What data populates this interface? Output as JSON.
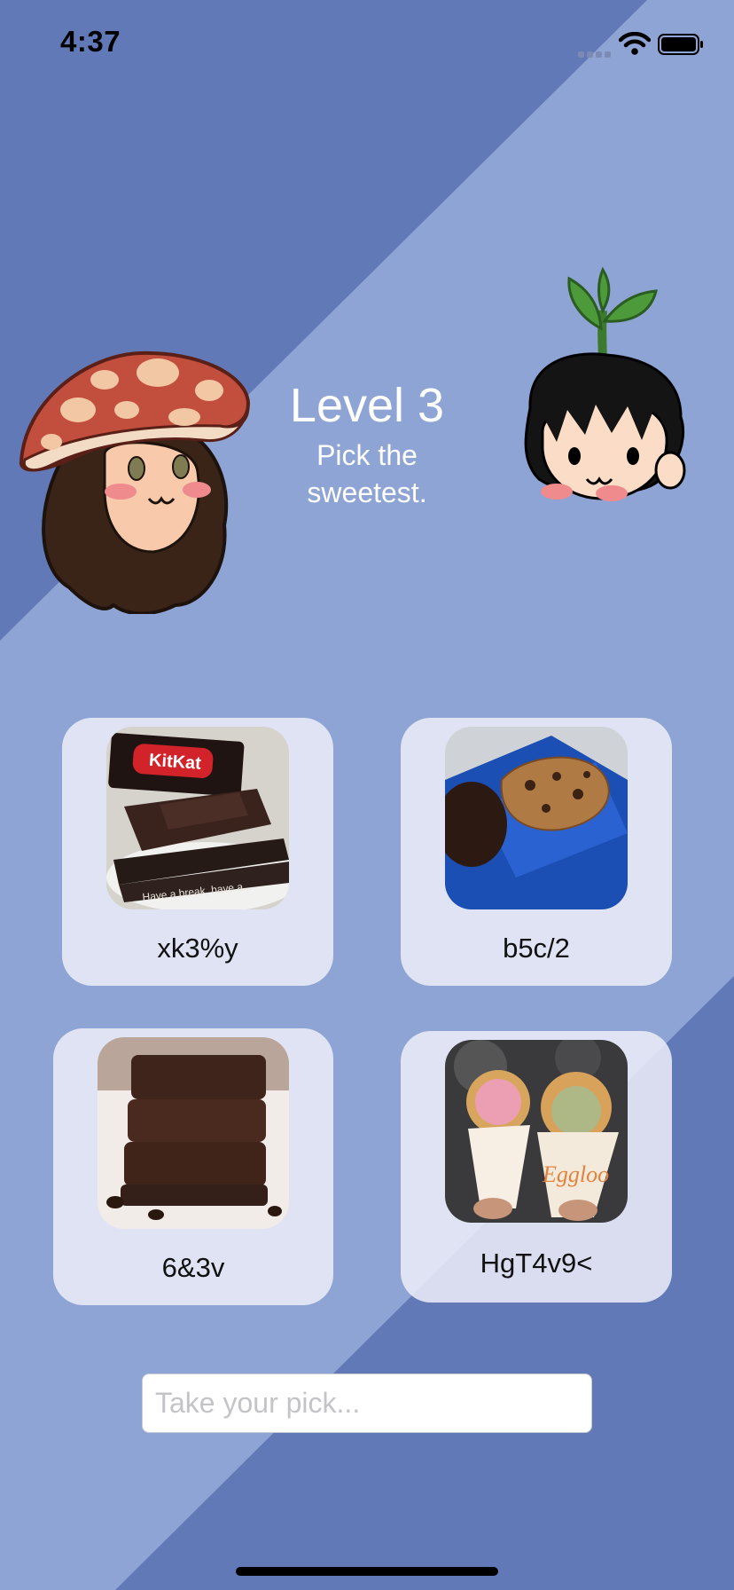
{
  "status_bar": {
    "time": "4:37",
    "icons": [
      "cellular-signal-icon",
      "wifi-icon",
      "battery-icon"
    ]
  },
  "colors": {
    "background_dark": "#6279b7",
    "background_light": "#8ea4d4",
    "card_fill": "#eceef8",
    "title_text": "#ffffff"
  },
  "header": {
    "title": "Level 3",
    "subtitle": "Pick the sweetest."
  },
  "characters": [
    "mushroom-girl-avatar",
    "sprout-boy-avatar"
  ],
  "options": [
    {
      "image": "kitkat-dark-chocolate-photo",
      "label": "xk3%y"
    },
    {
      "image": "cookie-bar-photo",
      "label": "b5c/2"
    },
    {
      "image": "brownie-stack-photo",
      "label": "6&3v"
    },
    {
      "image": "bubble-waffle-ice-cream-photo",
      "label": "HgT4v9<"
    }
  ],
  "input": {
    "value": "",
    "placeholder": "Take your pick..."
  }
}
